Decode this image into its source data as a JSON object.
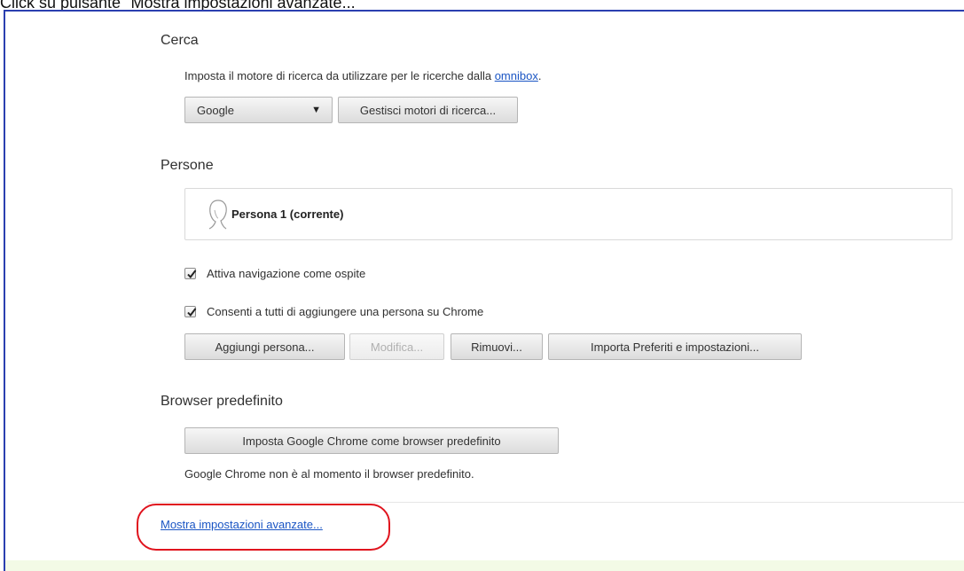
{
  "caption": "Click su pulsante \"Mostra impostazioni avanzate...\"",
  "search": {
    "title": "Cerca",
    "description_prefix": "Imposta il motore di ricerca da utilizzare per le ricerche dalla ",
    "description_link": "omnibox",
    "description_suffix": ".",
    "engine_selected": "Google",
    "manage_button": "Gestisci motori di ricerca..."
  },
  "people": {
    "title": "Persone",
    "profile_name": "Persona 1 (corrente)",
    "guest_checkbox": {
      "label": "Attiva navigazione come ospite",
      "checked": true
    },
    "add_person_checkbox": {
      "label": "Consenti a tutti di aggiungere una persona su Chrome",
      "checked": true
    },
    "buttons": {
      "add": "Aggiungi persona...",
      "edit": "Modifica...",
      "remove": "Rimuovi...",
      "import": "Importa Preferiti e impostazioni..."
    }
  },
  "default_browser": {
    "title": "Browser predefinito",
    "set_button": "Imposta Google Chrome come browser predefinito",
    "status": "Google Chrome non è al momento il browser predefinito."
  },
  "advanced_link": "Mostra impostazioni avanzate...",
  "colors": {
    "frame_border": "#2b3fb0",
    "link": "#1a55c4",
    "highlight": "#e0141e"
  }
}
